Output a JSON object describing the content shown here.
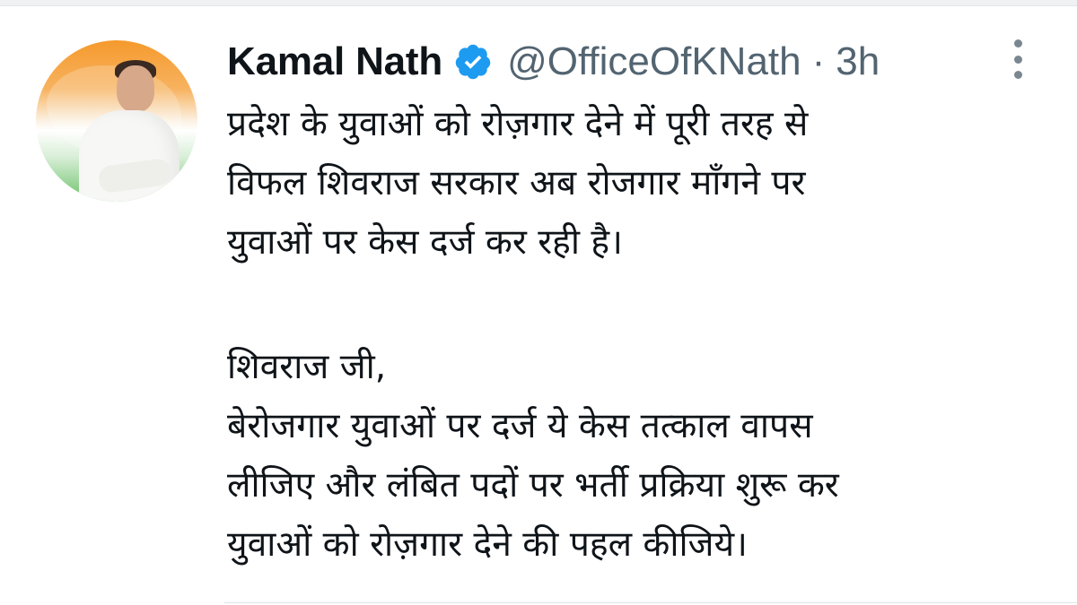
{
  "tweet": {
    "author_name": "Kamal Nath",
    "handle": "@OfficeOfKNath",
    "separator": "·",
    "time": "3h",
    "verified_color": "#1d9bf0",
    "icons": {
      "verified": "verified-badge-icon",
      "more": "more-options-icon"
    },
    "paragraph1": [
      "प्रदेश के युवाओं को रोज़गार देने में पूरी तरह से",
      "विफल शिवराज सरकार अब रोजगार माँगने पर",
      "युवाओं पर केस दर्ज कर रही है।"
    ],
    "paragraph2": [
      "शिवराज जी,",
      "बेरोजगार युवाओं पर दर्ज ये केस तत्काल वापस",
      "लीजिए और लंबित पदों पर भर्ती प्रक्रिया शुरू कर",
      "युवाओं को रोज़गार देने की पहल कीजिये।"
    ]
  }
}
